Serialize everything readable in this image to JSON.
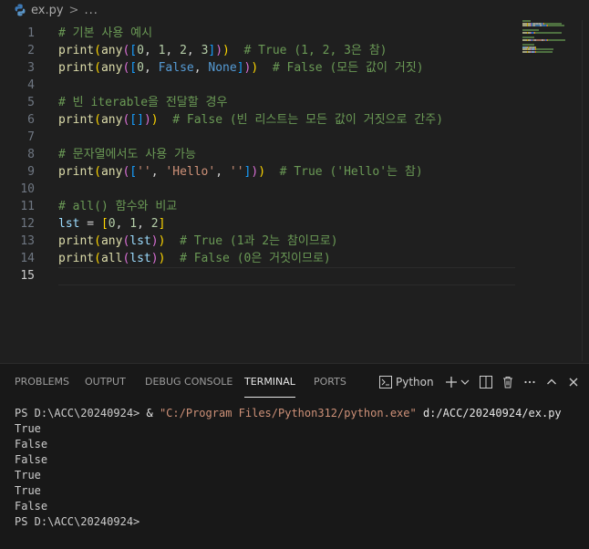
{
  "editor_tab": {
    "file_name": "ex.py",
    "separator": ">",
    "more": "..."
  },
  "colors": {
    "background": "#1f1f1f",
    "comment": "#6a9955",
    "function": "#dcdcaa",
    "keyword": "#569cd6",
    "number": "#b5cea8",
    "string": "#ce9178",
    "terminal_string": "#ce9178"
  },
  "editor": {
    "current_line": 15,
    "lines": [
      {
        "n": "1",
        "tokens": [
          {
            "t": "# 기본 사용 예시",
            "c": "cmt"
          }
        ]
      },
      {
        "n": "2",
        "tokens": [
          {
            "t": "print",
            "c": "fn"
          },
          {
            "t": "(",
            "c": "b1"
          },
          {
            "t": "any",
            "c": "fn"
          },
          {
            "t": "(",
            "c": "b2"
          },
          {
            "t": "[",
            "c": "b3"
          },
          {
            "t": "0",
            "c": "num"
          },
          {
            "t": ", ",
            "c": "op"
          },
          {
            "t": "1",
            "c": "num"
          },
          {
            "t": ", ",
            "c": "op"
          },
          {
            "t": "2",
            "c": "num"
          },
          {
            "t": ", ",
            "c": "op"
          },
          {
            "t": "3",
            "c": "num"
          },
          {
            "t": "]",
            "c": "b3"
          },
          {
            "t": ")",
            "c": "b2"
          },
          {
            "t": ")",
            "c": "b1"
          },
          {
            "t": "  # True (1, 2, 3은 참)",
            "c": "cmt"
          }
        ]
      },
      {
        "n": "3",
        "tokens": [
          {
            "t": "print",
            "c": "fn"
          },
          {
            "t": "(",
            "c": "b1"
          },
          {
            "t": "any",
            "c": "fn"
          },
          {
            "t": "(",
            "c": "b2"
          },
          {
            "t": "[",
            "c": "b3"
          },
          {
            "t": "0",
            "c": "num"
          },
          {
            "t": ", ",
            "c": "op"
          },
          {
            "t": "False",
            "c": "kw"
          },
          {
            "t": ", ",
            "c": "op"
          },
          {
            "t": "None",
            "c": "kw"
          },
          {
            "t": "]",
            "c": "b3"
          },
          {
            "t": ")",
            "c": "b2"
          },
          {
            "t": ")",
            "c": "b1"
          },
          {
            "t": "  # False (모든 값이 거짓)",
            "c": "cmt"
          }
        ]
      },
      {
        "n": "4",
        "tokens": []
      },
      {
        "n": "5",
        "tokens": [
          {
            "t": "# 빈 iterable을 전달할 경우",
            "c": "cmt"
          }
        ]
      },
      {
        "n": "6",
        "tokens": [
          {
            "t": "print",
            "c": "fn"
          },
          {
            "t": "(",
            "c": "b1"
          },
          {
            "t": "any",
            "c": "fn"
          },
          {
            "t": "(",
            "c": "b2"
          },
          {
            "t": "[",
            "c": "b3"
          },
          {
            "t": "]",
            "c": "b3"
          },
          {
            "t": ")",
            "c": "b2"
          },
          {
            "t": ")",
            "c": "b1"
          },
          {
            "t": "  # False (빈 리스트는 모든 값이 거짓으로 간주)",
            "c": "cmt"
          }
        ]
      },
      {
        "n": "7",
        "tokens": []
      },
      {
        "n": "8",
        "tokens": [
          {
            "t": "# 문자열에서도 사용 가능",
            "c": "cmt"
          }
        ]
      },
      {
        "n": "9",
        "tokens": [
          {
            "t": "print",
            "c": "fn"
          },
          {
            "t": "(",
            "c": "b1"
          },
          {
            "t": "any",
            "c": "fn"
          },
          {
            "t": "(",
            "c": "b2"
          },
          {
            "t": "[",
            "c": "b3"
          },
          {
            "t": "''",
            "c": "str"
          },
          {
            "t": ", ",
            "c": "op"
          },
          {
            "t": "'Hello'",
            "c": "str"
          },
          {
            "t": ", ",
            "c": "op"
          },
          {
            "t": "''",
            "c": "str"
          },
          {
            "t": "]",
            "c": "b3"
          },
          {
            "t": ")",
            "c": "b2"
          },
          {
            "t": ")",
            "c": "b1"
          },
          {
            "t": "  # True ('Hello'는 참)",
            "c": "cmt"
          }
        ]
      },
      {
        "n": "10",
        "tokens": []
      },
      {
        "n": "11",
        "tokens": [
          {
            "t": "# all() 함수와 비교",
            "c": "cmt"
          }
        ]
      },
      {
        "n": "12",
        "tokens": [
          {
            "t": "lst",
            "c": "var"
          },
          {
            "t": " = ",
            "c": "op"
          },
          {
            "t": "[",
            "c": "b1"
          },
          {
            "t": "0",
            "c": "num"
          },
          {
            "t": ", ",
            "c": "op"
          },
          {
            "t": "1",
            "c": "num"
          },
          {
            "t": ", ",
            "c": "op"
          },
          {
            "t": "2",
            "c": "num"
          },
          {
            "t": "]",
            "c": "b1"
          }
        ]
      },
      {
        "n": "13",
        "tokens": [
          {
            "t": "print",
            "c": "fn"
          },
          {
            "t": "(",
            "c": "b1"
          },
          {
            "t": "any",
            "c": "fn"
          },
          {
            "t": "(",
            "c": "b2"
          },
          {
            "t": "lst",
            "c": "var"
          },
          {
            "t": ")",
            "c": "b2"
          },
          {
            "t": ")",
            "c": "b1"
          },
          {
            "t": "  # True (1과 2는 참이므로)",
            "c": "cmt"
          }
        ]
      },
      {
        "n": "14",
        "tokens": [
          {
            "t": "print",
            "c": "fn"
          },
          {
            "t": "(",
            "c": "b1"
          },
          {
            "t": "all",
            "c": "fn"
          },
          {
            "t": "(",
            "c": "b2"
          },
          {
            "t": "lst",
            "c": "var"
          },
          {
            "t": ")",
            "c": "b2"
          },
          {
            "t": ")",
            "c": "b1"
          },
          {
            "t": "  # False (0은 거짓이므로)",
            "c": "cmt"
          }
        ]
      },
      {
        "n": "15",
        "tokens": []
      }
    ]
  },
  "panel": {
    "tabs": [
      "PROBLEMS",
      "OUTPUT",
      "DEBUG CONSOLE",
      "TERMINAL",
      "PORTS"
    ],
    "active_tab": "TERMINAL",
    "terminal_profile": "Python",
    "icons": [
      "terminal-icon",
      "plus-icon",
      "chevron-down-icon",
      "split-icon",
      "trash-icon",
      "more-icon",
      "chevron-up-icon",
      "close-icon"
    ]
  },
  "terminal": {
    "prompt": "PS D:\\ACC\\20240924> ",
    "command_amp": "& ",
    "command_exe": "\"C:/Program Files/Python312/python.exe\"",
    "command_arg": " d:/ACC/20240924/ex.py",
    "outputs": [
      "True",
      "False",
      "False",
      "True",
      "True",
      "False"
    ],
    "final_prompt": "PS D:\\ACC\\20240924>"
  }
}
